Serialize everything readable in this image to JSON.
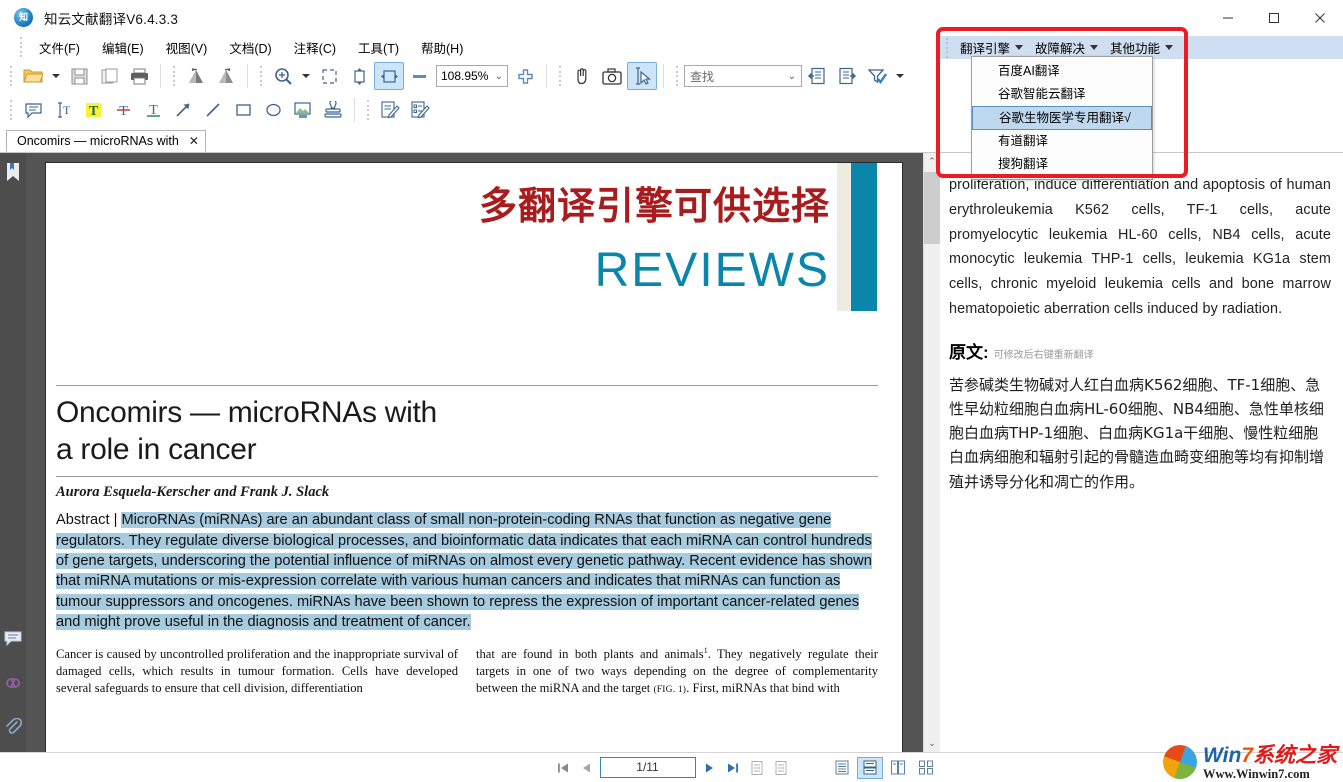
{
  "window": {
    "title": "知云文献翻译V6.4.3.3",
    "logo_text": "知",
    "minimize": "—",
    "maximize": "□",
    "close": "✕"
  },
  "menubar": {
    "items": [
      {
        "label": "文件(F)"
      },
      {
        "label": "编辑(E)"
      },
      {
        "label": "视图(V)"
      },
      {
        "label": "文档(D)"
      },
      {
        "label": "注释(C)"
      },
      {
        "label": "工具(T)"
      },
      {
        "label": "帮助(H)"
      }
    ]
  },
  "toolbar": {
    "zoom_value": "108.95%",
    "find_placeholder": "查找",
    "icons_row1": [
      "open-folder-icon",
      "save-icon",
      "save-copy-icon",
      "print-icon",
      "rotate-left-icon",
      "rotate-right-icon",
      "zoom-icon",
      "fit-page-icon",
      "fit-height-icon",
      "fit-width-icon",
      "zoom-out-icon",
      "zoom-in-icon",
      "hand-tool-icon",
      "snapshot-icon",
      "select-text-icon"
    ],
    "icons_row2": [
      "note-icon",
      "text-select-icon",
      "highlight-icon",
      "strikeout-icon",
      "underline-icon",
      "arrow-icon",
      "line-icon",
      "rectangle-icon",
      "ellipse-icon",
      "image-stamp-icon",
      "stamp-icon",
      "sign-icon",
      "form-icon"
    ]
  },
  "right_menu": {
    "items": [
      {
        "label": "翻译引擎"
      },
      {
        "label": "故障解决"
      },
      {
        "label": "其他功能"
      }
    ]
  },
  "dropdown": {
    "open_for": "翻译引擎",
    "items": [
      {
        "label": "百度AI翻译",
        "selected": false
      },
      {
        "label": "谷歌智能云翻译",
        "selected": false
      },
      {
        "label": "谷歌生物医学专用翻译√",
        "selected": true
      },
      {
        "label": "有道翻译",
        "selected": false
      },
      {
        "label": "搜狗翻译",
        "selected": false
      }
    ],
    "highlight_color": "#ec1c24"
  },
  "tabs": [
    {
      "label": "Oncomirs — microRNAs with",
      "close": "✕",
      "active": true
    }
  ],
  "left_rail": {
    "icons": [
      "bookmark-icon",
      "comment-icon",
      "signature-icon",
      "attachment-icon"
    ]
  },
  "document": {
    "banner_cn": "多翻译引擎可供选择",
    "banner_en": "REVIEWS",
    "banner_color": "#0b86ab",
    "banner_cn_color": "#a81c1e",
    "title": "Oncomirs — microRNAs with\na role in cancer",
    "authors": "Aurora Esquela-Kerscher and Frank J. Slack",
    "abstract_label": "Abstract | ",
    "abstract_text": "MicroRNAs (miRNAs) are an abundant class of small non-protein-coding RNAs that function as negative gene regulators. They regulate diverse biological processes, and bioinformatic data indicates that each miRNA can control hundreds of gene targets, underscoring the potential influence of miRNAs on almost every genetic pathway. Recent evidence has shown that miRNA mutations or mis-expression correlate with various human cancers and indicates that miRNAs can function as tumour suppressors and oncogenes. miRNAs have been shown to repress the expression of important cancer-related genes and might prove useful in the diagnosis and treatment of cancer.",
    "body_left": "Cancer is caused by uncontrolled proliferation and the inappropriate survival of damaged cells, which results in tumour formation. Cells have developed several safeguards to ensure that cell division, differentiation",
    "body_right_1": "that are found in both plants and animals",
    "body_right_sup": "1",
    "body_right_2": ". They negatively regulate their targets in one of two ways depending on the degree of complementarity between the miRNA and the target ",
    "body_right_figref": "(FIG. 1)",
    "body_right_3": ". First, miRNAs that bind with"
  },
  "translation": {
    "english": "                                                proliferation, induce differentiation and apoptosis of human erythroleukemia K562 cells, TF-1 cells, acute promyelocytic leukemia HL-60 cells, NB4 cells, acute monocytic leukemia THP-1 cells, leukemia KG1a stem cells, chronic myeloid leukemia cells and bone marrow hematopoietic aberration cells induced by radiation.",
    "source_label": "原文:",
    "source_hint": "可修改后右键重新翻译",
    "chinese": "苦参碱类生物碱对人红白血病K562细胞、TF-1细胞、急性早幼粒细胞白血病HL-60细胞、NB4细胞、急性单核细胞白血病THP-1细胞、白血病KG1a干细胞、慢性粒细胞白血病细胞和辐射引起的骨髓造血畸变细胞等均有抑制增殖并诱导分化和凋亡的作用。"
  },
  "statusbar": {
    "first_page": "first-page-icon",
    "prev_page": "prev-page-icon",
    "page_value": "1/11",
    "next_page": "next-page-icon",
    "last_page": "last-page-icon",
    "view_modes": [
      "single-page-icon",
      "continuous-page-icon",
      "two-page-icon",
      "two-page-cover-icon"
    ],
    "active_view_mode": 1
  },
  "watermark": {
    "line1_part1": "Win",
    "line1_part2": "7",
    "line1_part3": "系统之家",
    "line2": "Www.Winwin7.com"
  }
}
